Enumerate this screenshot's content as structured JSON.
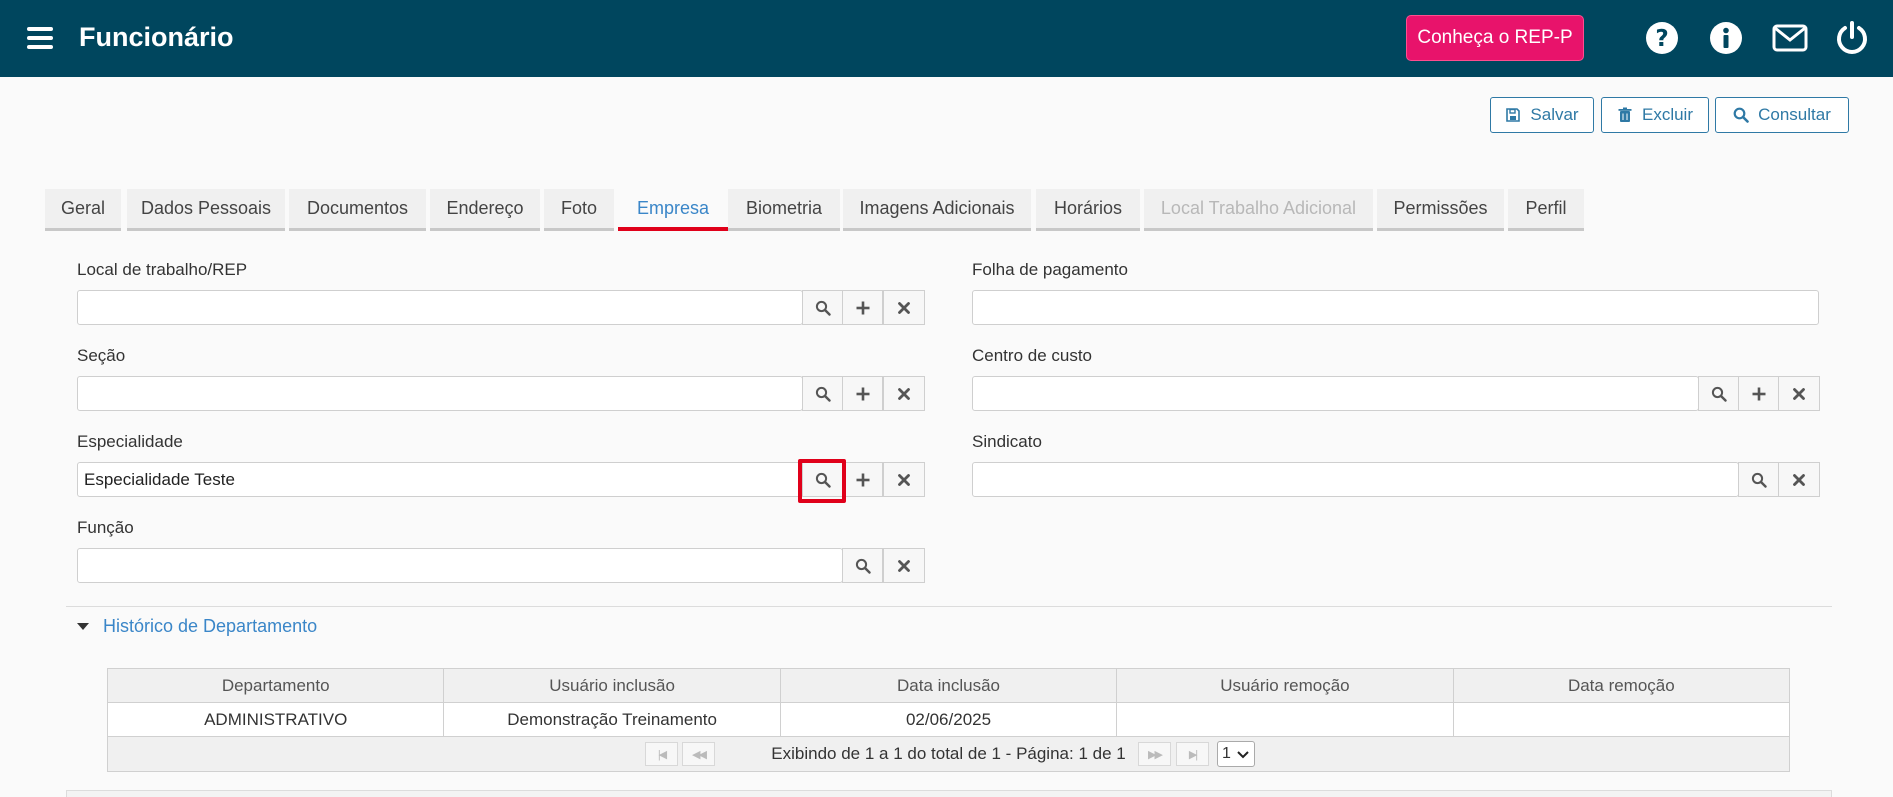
{
  "header": {
    "title": "Funcionário",
    "rep_button": "Conheça o REP-P",
    "icons": [
      "menu-icon",
      "help-icon",
      "info-icon",
      "mail-icon",
      "power-icon"
    ]
  },
  "actions": {
    "save": "Salvar",
    "delete": "Excluir",
    "search": "Consultar"
  },
  "tabs": [
    {
      "label": "Geral"
    },
    {
      "label": "Dados Pessoais"
    },
    {
      "label": "Documentos"
    },
    {
      "label": "Endereço"
    },
    {
      "label": "Foto"
    },
    {
      "label": "Empresa",
      "active": true
    },
    {
      "label": "Biometria"
    },
    {
      "label": "Imagens Adicionais"
    },
    {
      "label": "Horários"
    },
    {
      "label": "Local Trabalho Adicional",
      "disabled": true
    },
    {
      "label": "Permissões"
    },
    {
      "label": "Perfil"
    }
  ],
  "form": {
    "local_trabalho": {
      "label": "Local de trabalho/REP",
      "value": ""
    },
    "secao": {
      "label": "Seção",
      "value": ""
    },
    "especialidade": {
      "label": "Especialidade",
      "value": "Especialidade Teste"
    },
    "funcao": {
      "label": "Função",
      "value": ""
    },
    "folha_pagamento": {
      "label": "Folha de pagamento",
      "value": ""
    },
    "centro_custo": {
      "label": "Centro de custo",
      "value": ""
    },
    "sindicato": {
      "label": "Sindicato",
      "value": ""
    }
  },
  "history": {
    "title": "Histórico de Departamento",
    "columns": [
      "Departamento",
      "Usuário inclusão",
      "Data inclusão",
      "Usuário remoção",
      "Data remoção"
    ],
    "rows": [
      [
        "ADMINISTRATIVO",
        "Demonstração Treinamento",
        "02/06/2025",
        "",
        ""
      ]
    ],
    "pager_text": "Exibindo de 1 a 1 do total de 1 - Página: 1 de 1",
    "page_selected": "1"
  },
  "colors": {
    "header_bg": "#00465e",
    "rep_button": "#e8136b",
    "accent": "#3a86c8",
    "active_tab_underline": "#e0001a",
    "highlight": "#e0001a"
  }
}
